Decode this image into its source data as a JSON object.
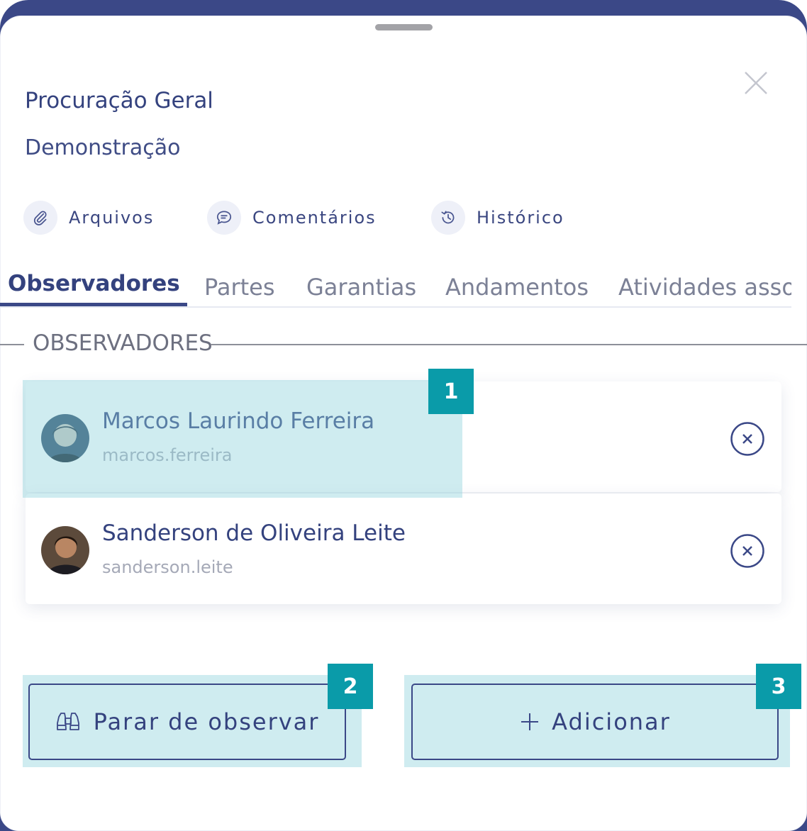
{
  "header": {
    "title": "Procuração Geral",
    "subtitle": "Demonstração"
  },
  "actions": [
    {
      "label": "Arquivos",
      "icon": "paperclip-icon"
    },
    {
      "label": "Comentários",
      "icon": "chat-bubble-icon"
    },
    {
      "label": "Histórico",
      "icon": "history-icon"
    }
  ],
  "tabs": [
    {
      "label": "Observadores",
      "active": true
    },
    {
      "label": "Partes"
    },
    {
      "label": "Garantias"
    },
    {
      "label": "Andamentos"
    },
    {
      "label": "Atividades asso"
    }
  ],
  "section": {
    "legend": "OBSERVADORES"
  },
  "observers": [
    {
      "name": "Marcos Laurindo Ferreira",
      "username": "marcos.ferreira"
    },
    {
      "name": "Sanderson de Oliveira Leite",
      "username": "sanderson.leite"
    }
  ],
  "buttons": {
    "stop_label": "Parar de observar",
    "add_label": "Adicionar"
  },
  "badges": [
    "1",
    "2",
    "3"
  ],
  "colors": {
    "primary": "#3b4887",
    "highlight": "#cdebef",
    "badge": "#0a9ba9"
  }
}
